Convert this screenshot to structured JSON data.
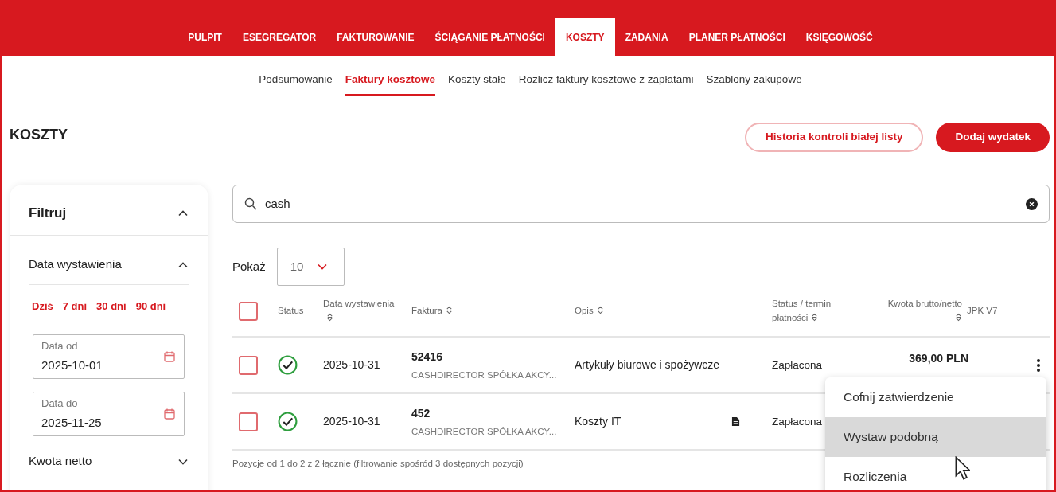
{
  "nav": {
    "items": [
      {
        "label": "PULPIT",
        "selected": false
      },
      {
        "label": "ESEGREGATOR",
        "selected": false
      },
      {
        "label": "FAKTUROWANIE",
        "selected": false
      },
      {
        "label": "ŚCIĄGANIE PŁATNOŚCI",
        "selected": false
      },
      {
        "label": "KOSZTY",
        "selected": true
      },
      {
        "label": "ZADANIA",
        "selected": false
      },
      {
        "label": "PLANER PŁATNOŚCI",
        "selected": false
      },
      {
        "label": "KSIĘGOWOŚĆ",
        "selected": false
      }
    ]
  },
  "subnav": {
    "items": [
      {
        "label": "Podsumowanie",
        "selected": false
      },
      {
        "label": "Faktury kosztowe",
        "selected": true
      },
      {
        "label": "Koszty stałe",
        "selected": false
      },
      {
        "label": "Rozlicz faktury kosztowe z zapłatami",
        "selected": false
      },
      {
        "label": "Szablony zakupowe",
        "selected": false
      }
    ]
  },
  "page_title": "KOSZTY",
  "buttons": [
    {
      "label": "Historia kontroli białej listy",
      "kind": "outline"
    },
    {
      "label": "Dodaj wydatek",
      "kind": "primary"
    }
  ],
  "filter": {
    "title": "Filtruj",
    "expanded": true,
    "sections": [
      {
        "title": "Data wystawienia",
        "expanded": true,
        "quick_ranges": [
          "Dziś",
          "7 dni",
          "30 dni",
          "90 dni"
        ],
        "fields": [
          {
            "label": "Data od",
            "value": "2025-10-01"
          },
          {
            "label": "Data do",
            "value": "2025-11-25"
          }
        ]
      },
      {
        "title": "Kwota netto",
        "expanded": false
      }
    ]
  },
  "search": {
    "value": "cash"
  },
  "page_size": {
    "label": "Pokaż",
    "value": "10"
  },
  "table": {
    "all_checked": false,
    "columns": [
      {
        "label": "Status",
        "sortable": false
      },
      {
        "label": "Data wystawienia",
        "sortable": true
      },
      {
        "label": "Faktura",
        "sortable": true
      },
      {
        "label": "Opis",
        "sortable": true
      },
      {
        "label": "Status / termin płatności",
        "sortable": true
      },
      {
        "label": "Kwota brutto/netto",
        "sortable": true
      },
      {
        "label": "JPK V7",
        "sortable": false
      }
    ],
    "rows": [
      {
        "checked": false,
        "paid": true,
        "date": "2025-10-31",
        "number": "52416",
        "company": "CASHDIRECTOR SPÓŁKA AKCY...",
        "description": "Artykuły biurowe i spożywcze",
        "attachment": false,
        "status": "Zapłacona",
        "gross": "369,00 PLN"
      },
      {
        "checked": false,
        "paid": true,
        "date": "2025-10-31",
        "number": "452",
        "company": "CASHDIRECTOR SPÓŁKA AKCY...",
        "description": "Koszty IT",
        "attachment": true,
        "status": "Zapłacona"
      }
    ],
    "footer": "Pozycje od 1 do 2 z 2 łącznie (filtrowanie spośród 3 dostępnych pozycji)"
  },
  "context_menu": {
    "items": [
      {
        "label": "Cofnij zatwierdzenie",
        "selected": false
      },
      {
        "label": "Wystaw podobną",
        "selected": true
      },
      {
        "label": "Rozliczenia",
        "selected": false
      }
    ]
  }
}
